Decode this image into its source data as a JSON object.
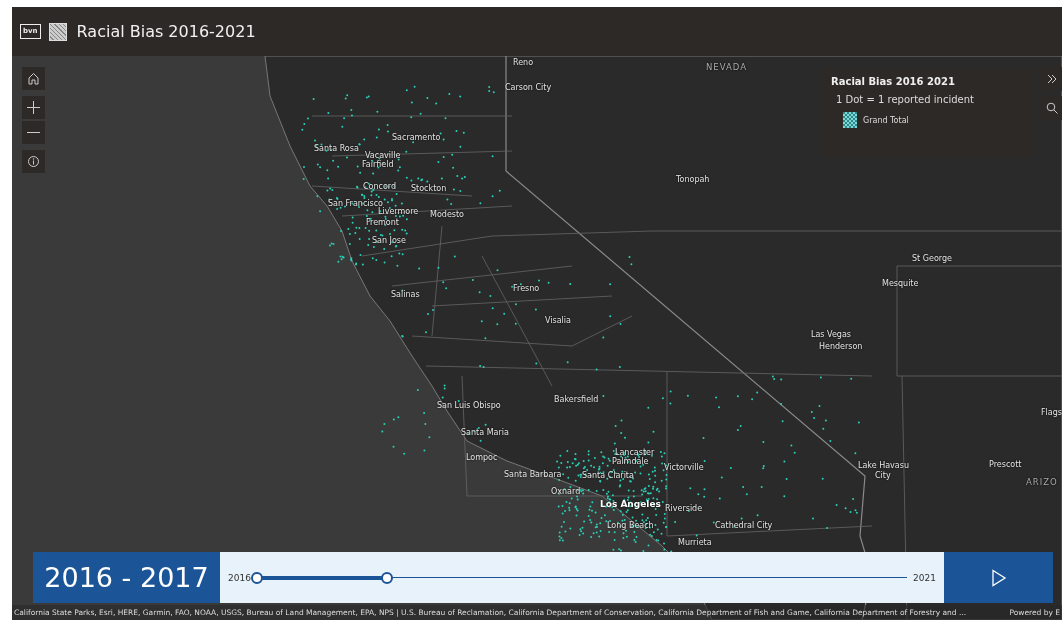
{
  "header": {
    "logo_text": "bvn",
    "title": "Racial Bias 2016-2021"
  },
  "map": {
    "labels": [
      {
        "text": "Reno",
        "kind": "city"
      },
      {
        "text": "NEVADA",
        "kind": "region"
      },
      {
        "text": "Carson City",
        "kind": "city"
      },
      {
        "text": "Sacramento",
        "kind": "city"
      },
      {
        "text": "Santa Rosa",
        "kind": "city"
      },
      {
        "text": "Vacaville",
        "kind": "city"
      },
      {
        "text": "Fairfield",
        "kind": "city"
      },
      {
        "text": "Tonopah",
        "kind": "city"
      },
      {
        "text": "Concord",
        "kind": "city"
      },
      {
        "text": "Stockton",
        "kind": "city"
      },
      {
        "text": "San Francisco",
        "kind": "city"
      },
      {
        "text": "Livermore",
        "kind": "city"
      },
      {
        "text": "Modesto",
        "kind": "city"
      },
      {
        "text": "Fremont",
        "kind": "city"
      },
      {
        "text": "San Jose",
        "kind": "city"
      },
      {
        "text": "St George",
        "kind": "city"
      },
      {
        "text": "Mesquite",
        "kind": "city"
      },
      {
        "text": "Fresno",
        "kind": "city"
      },
      {
        "text": "Salinas",
        "kind": "city"
      },
      {
        "text": "Visalia",
        "kind": "city"
      },
      {
        "text": "Las Vegas",
        "kind": "city"
      },
      {
        "text": "Henderson",
        "kind": "city"
      },
      {
        "text": "Bakersfield",
        "kind": "city"
      },
      {
        "text": "San Luis Obispo",
        "kind": "city"
      },
      {
        "text": "Flags",
        "kind": "city"
      },
      {
        "text": "Santa Maria",
        "kind": "city"
      },
      {
        "text": "Lompoc",
        "kind": "city"
      },
      {
        "text": "Lancaster",
        "kind": "city"
      },
      {
        "text": "Palmdale",
        "kind": "city"
      },
      {
        "text": "Victorville",
        "kind": "city"
      },
      {
        "text": "Lake Havasu",
        "kind": "city"
      },
      {
        "text": "City",
        "kind": "city"
      },
      {
        "text": "Prescott",
        "kind": "city"
      },
      {
        "text": "Santa Barbara",
        "kind": "city"
      },
      {
        "text": "Santa Clarita",
        "kind": "city"
      },
      {
        "text": "ARIZO",
        "kind": "region"
      },
      {
        "text": "Oxnard",
        "kind": "city"
      },
      {
        "text": "Los Angeles",
        "kind": "major"
      },
      {
        "text": "Riverside",
        "kind": "city"
      },
      {
        "text": "Long Beach",
        "kind": "city"
      },
      {
        "text": "Cathedral City",
        "kind": "city"
      },
      {
        "text": "Murrieta",
        "kind": "city"
      }
    ]
  },
  "legend": {
    "title": "Racial Bias 2016 2021",
    "description": "1 Dot = 1 reported incident",
    "items": [
      {
        "label": "Grand Total"
      }
    ]
  },
  "time_slider": {
    "current": "2016 - 2017",
    "min_label": "2016",
    "max_label": "2021",
    "thumbs": [
      {
        "level": 0
      },
      {
        "level": 0.2
      }
    ]
  },
  "attribution": {
    "text": "California State Parks, Esri, HERE, Garmin, FAO, NOAA, USGS, Bureau of Land Management, EPA, NPS | U.S. Bureau of Reclamation, California Department of Conservation, California Department of Fish and Game, California Department of Forestry and ...",
    "powered_by": "Powered by E"
  }
}
